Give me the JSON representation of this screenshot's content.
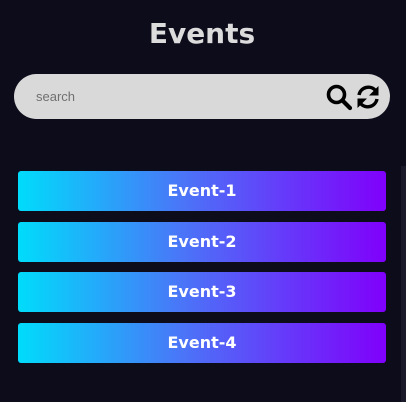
{
  "page": {
    "title": "Events",
    "background": "#0c0c1b"
  },
  "search": {
    "placeholder": "search",
    "value": "",
    "search_icon": "magnifier-icon",
    "refresh_icon": "refresh-arrows-icon"
  },
  "events": [
    {
      "label": "Event-1"
    },
    {
      "label": "Event-2"
    },
    {
      "label": "Event-3"
    },
    {
      "label": "Event-4"
    }
  ],
  "colors": {
    "gradient_start": "#00dcfb",
    "gradient_end": "#8000fb",
    "search_bg": "#d9d9d9",
    "title_text": "#dcdcdc"
  }
}
